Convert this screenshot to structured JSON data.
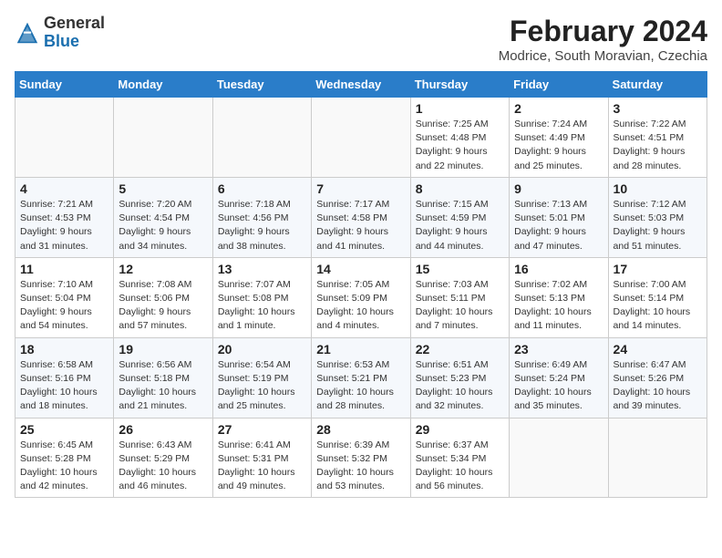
{
  "header": {
    "logo": {
      "general": "General",
      "blue": "Blue",
      "icon_color": "#1a6faf"
    },
    "title": "February 2024",
    "subtitle": "Modrice, South Moravian, Czechia"
  },
  "calendar": {
    "days_of_week": [
      "Sunday",
      "Monday",
      "Tuesday",
      "Wednesday",
      "Thursday",
      "Friday",
      "Saturday"
    ],
    "weeks": [
      [
        {
          "day": "",
          "info": ""
        },
        {
          "day": "",
          "info": ""
        },
        {
          "day": "",
          "info": ""
        },
        {
          "day": "",
          "info": ""
        },
        {
          "day": "1",
          "info": "Sunrise: 7:25 AM\nSunset: 4:48 PM\nDaylight: 9 hours\nand 22 minutes."
        },
        {
          "day": "2",
          "info": "Sunrise: 7:24 AM\nSunset: 4:49 PM\nDaylight: 9 hours\nand 25 minutes."
        },
        {
          "day": "3",
          "info": "Sunrise: 7:22 AM\nSunset: 4:51 PM\nDaylight: 9 hours\nand 28 minutes."
        }
      ],
      [
        {
          "day": "4",
          "info": "Sunrise: 7:21 AM\nSunset: 4:53 PM\nDaylight: 9 hours\nand 31 minutes."
        },
        {
          "day": "5",
          "info": "Sunrise: 7:20 AM\nSunset: 4:54 PM\nDaylight: 9 hours\nand 34 minutes."
        },
        {
          "day": "6",
          "info": "Sunrise: 7:18 AM\nSunset: 4:56 PM\nDaylight: 9 hours\nand 38 minutes."
        },
        {
          "day": "7",
          "info": "Sunrise: 7:17 AM\nSunset: 4:58 PM\nDaylight: 9 hours\nand 41 minutes."
        },
        {
          "day": "8",
          "info": "Sunrise: 7:15 AM\nSunset: 4:59 PM\nDaylight: 9 hours\nand 44 minutes."
        },
        {
          "day": "9",
          "info": "Sunrise: 7:13 AM\nSunset: 5:01 PM\nDaylight: 9 hours\nand 47 minutes."
        },
        {
          "day": "10",
          "info": "Sunrise: 7:12 AM\nSunset: 5:03 PM\nDaylight: 9 hours\nand 51 minutes."
        }
      ],
      [
        {
          "day": "11",
          "info": "Sunrise: 7:10 AM\nSunset: 5:04 PM\nDaylight: 9 hours\nand 54 minutes."
        },
        {
          "day": "12",
          "info": "Sunrise: 7:08 AM\nSunset: 5:06 PM\nDaylight: 9 hours\nand 57 minutes."
        },
        {
          "day": "13",
          "info": "Sunrise: 7:07 AM\nSunset: 5:08 PM\nDaylight: 10 hours\nand 1 minute."
        },
        {
          "day": "14",
          "info": "Sunrise: 7:05 AM\nSunset: 5:09 PM\nDaylight: 10 hours\nand 4 minutes."
        },
        {
          "day": "15",
          "info": "Sunrise: 7:03 AM\nSunset: 5:11 PM\nDaylight: 10 hours\nand 7 minutes."
        },
        {
          "day": "16",
          "info": "Sunrise: 7:02 AM\nSunset: 5:13 PM\nDaylight: 10 hours\nand 11 minutes."
        },
        {
          "day": "17",
          "info": "Sunrise: 7:00 AM\nSunset: 5:14 PM\nDaylight: 10 hours\nand 14 minutes."
        }
      ],
      [
        {
          "day": "18",
          "info": "Sunrise: 6:58 AM\nSunset: 5:16 PM\nDaylight: 10 hours\nand 18 minutes."
        },
        {
          "day": "19",
          "info": "Sunrise: 6:56 AM\nSunset: 5:18 PM\nDaylight: 10 hours\nand 21 minutes."
        },
        {
          "day": "20",
          "info": "Sunrise: 6:54 AM\nSunset: 5:19 PM\nDaylight: 10 hours\nand 25 minutes."
        },
        {
          "day": "21",
          "info": "Sunrise: 6:53 AM\nSunset: 5:21 PM\nDaylight: 10 hours\nand 28 minutes."
        },
        {
          "day": "22",
          "info": "Sunrise: 6:51 AM\nSunset: 5:23 PM\nDaylight: 10 hours\nand 32 minutes."
        },
        {
          "day": "23",
          "info": "Sunrise: 6:49 AM\nSunset: 5:24 PM\nDaylight: 10 hours\nand 35 minutes."
        },
        {
          "day": "24",
          "info": "Sunrise: 6:47 AM\nSunset: 5:26 PM\nDaylight: 10 hours\nand 39 minutes."
        }
      ],
      [
        {
          "day": "25",
          "info": "Sunrise: 6:45 AM\nSunset: 5:28 PM\nDaylight: 10 hours\nand 42 minutes."
        },
        {
          "day": "26",
          "info": "Sunrise: 6:43 AM\nSunset: 5:29 PM\nDaylight: 10 hours\nand 46 minutes."
        },
        {
          "day": "27",
          "info": "Sunrise: 6:41 AM\nSunset: 5:31 PM\nDaylight: 10 hours\nand 49 minutes."
        },
        {
          "day": "28",
          "info": "Sunrise: 6:39 AM\nSunset: 5:32 PM\nDaylight: 10 hours\nand 53 minutes."
        },
        {
          "day": "29",
          "info": "Sunrise: 6:37 AM\nSunset: 5:34 PM\nDaylight: 10 hours\nand 56 minutes."
        },
        {
          "day": "",
          "info": ""
        },
        {
          "day": "",
          "info": ""
        }
      ]
    ]
  }
}
